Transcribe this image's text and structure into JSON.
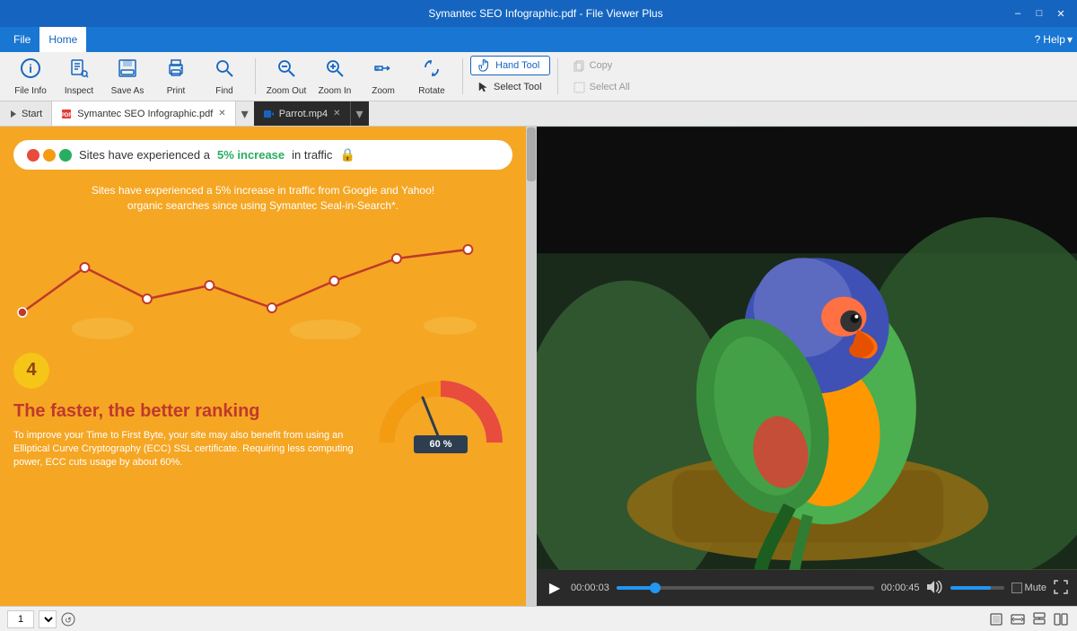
{
  "titleBar": {
    "title": "Symantec SEO Infographic.pdf - File Viewer Plus",
    "minimize": "–",
    "maximize": "□",
    "close": "✕"
  },
  "menuBar": {
    "items": [
      "File",
      "Home"
    ],
    "activeItem": "Home",
    "helpLabel": "Help"
  },
  "toolbar": {
    "tools": [
      {
        "name": "file-info",
        "icon": "ℹ",
        "label": "File Info"
      },
      {
        "name": "inspect",
        "icon": "🔍",
        "label": "Inspect"
      },
      {
        "name": "save-as",
        "icon": "💾",
        "label": "Save As"
      },
      {
        "name": "print",
        "icon": "🖨",
        "label": "Print"
      },
      {
        "name": "find",
        "icon": "🔎",
        "label": "Find"
      },
      {
        "name": "zoom-out",
        "icon": "🔍",
        "label": "Zoom Out"
      },
      {
        "name": "zoom-in",
        "icon": "🔍",
        "label": "Zoom In"
      },
      {
        "name": "zoom",
        "icon": "⊕",
        "label": "Zoom"
      },
      {
        "name": "rotate",
        "icon": "↻",
        "label": "Rotate"
      }
    ],
    "handToolLabel": "Hand Tool",
    "selectToolLabel": "Select Tool",
    "copyLabel": "Copy",
    "selectAllLabel": "Select All"
  },
  "tabs": {
    "startLabel": "Start",
    "pdfTab": {
      "label": "Symantec SEO Infographic.pdf"
    },
    "videoTab": {
      "label": "Parrot.mp4"
    }
  },
  "infographic": {
    "dots": [
      "red",
      "orange",
      "green"
    ],
    "bannerText": "Sites have experienced a ",
    "bannerHighlight": "5% increase",
    "bannerEnd": " in traffic",
    "descLine1": "Sites have experienced a 5% increase in traffic from Google and Yahoo!",
    "descLine2": "organic searches since using Symantec Seal-in-Search*.",
    "sectionNum": "4",
    "sectionTitle": "The faster, the better ranking",
    "sectionDesc": "To improve your Time to First Byte, your site may also benefit from using an Elliptical Curve Cryptography (ECC) SSL certificate. Requiring less computing power, ECC cuts usage by about 60%."
  },
  "video": {
    "currentTime": "00:00:03",
    "totalTime": "00:00:45",
    "muteLabel": "Mute",
    "progressPercent": 15,
    "volumePercent": 75
  },
  "bottomBar": {
    "pageNum": "1"
  }
}
